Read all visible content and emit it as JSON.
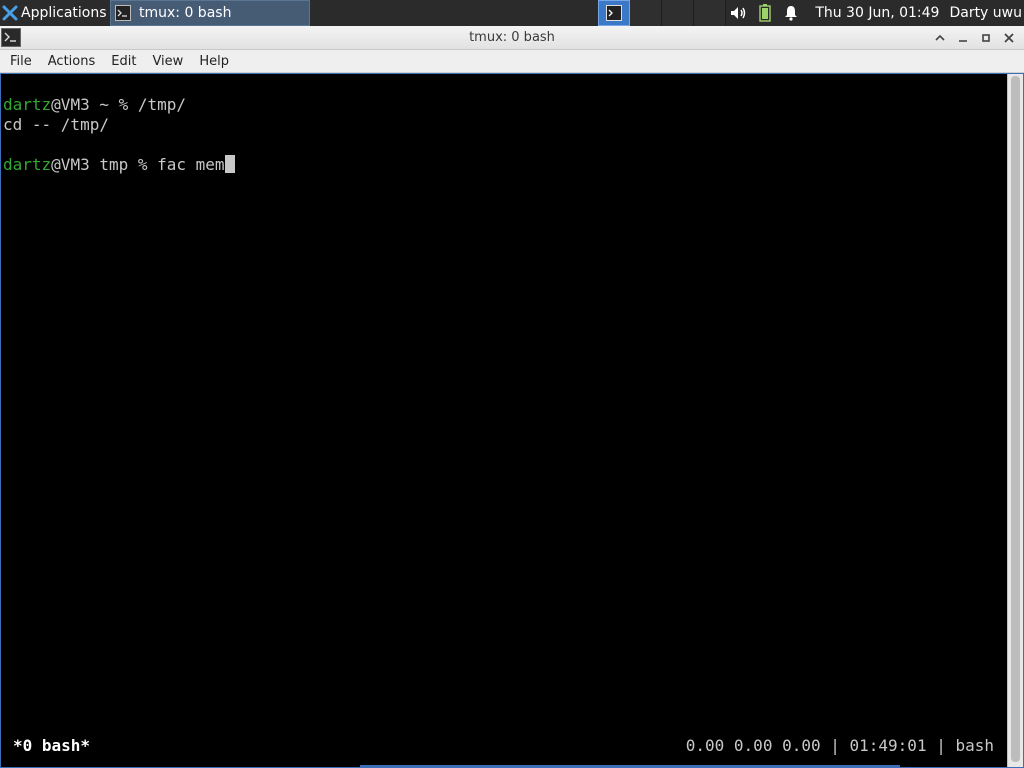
{
  "panel": {
    "applications_label": "Applications",
    "applications_sep": "⋮",
    "task_label": "tmux: 0 bash",
    "clock": "Thu 30 Jun, 01:49",
    "user": "Darty uwu",
    "icons": [
      "xfce-logo-icon",
      "terminal-icon",
      "volume-icon",
      "battery-icon",
      "notification-bell-icon"
    ]
  },
  "window": {
    "title": "tmux: 0 bash",
    "controls": [
      "shade-up-icon",
      "minimize-icon",
      "maximize-icon",
      "close-icon"
    ]
  },
  "menubar": {
    "items": [
      "File",
      "Actions",
      "Edit",
      "View",
      "Help"
    ]
  },
  "terminal": {
    "lines": [
      {
        "user": "dartz",
        "rest": "@VM3 ~ % /tmp/"
      },
      {
        "text": "cd -- /tmp/"
      },
      {
        "user": "dartz",
        "rest": "@VM3 tmp % fac mem"
      }
    ],
    "status_left": "*0 bash*",
    "status_right": "0.00 0.00 0.00 | 01:49:01 | bash",
    "colors": {
      "prompt_user": "#33a833",
      "text": "#c8c8c8",
      "background": "#000000"
    }
  }
}
